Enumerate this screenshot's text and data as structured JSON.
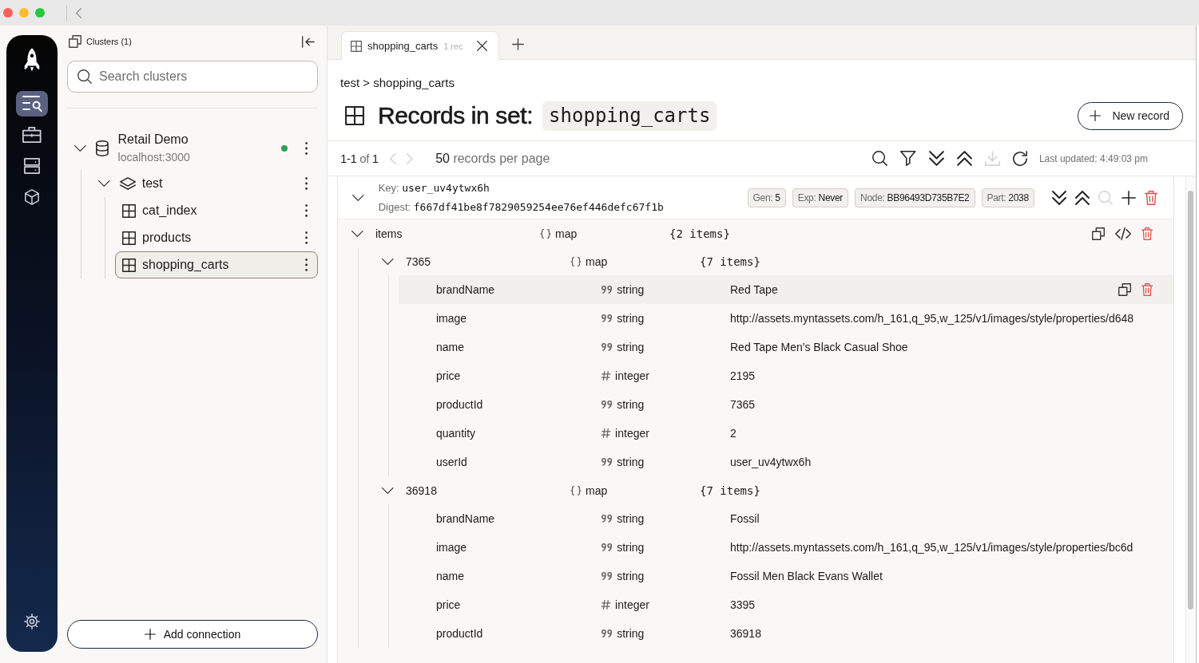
{
  "rail": {
    "items": [
      {
        "kind": "explorer",
        "selected": true
      },
      {
        "kind": "workspace",
        "selected": false
      },
      {
        "kind": "servers",
        "selected": false
      },
      {
        "kind": "modules",
        "selected": false
      }
    ],
    "footer": [
      {
        "kind": "settings",
        "selected": false
      }
    ]
  },
  "sidebar": {
    "title": "Clusters (1)",
    "search": {
      "placeholder": "Search clusters"
    },
    "tree": [
      {
        "kind": "cluster",
        "name": "Retail Demo",
        "host": "localhost:3000",
        "connected": true,
        "expanded": true,
        "selected": false,
        "children": [
          {
            "kind": "namespace",
            "name": "test",
            "expanded": true,
            "selected": false,
            "children": [
              {
                "kind": "set",
                "name": "cat_index",
                "selected": false
              },
              {
                "kind": "set",
                "name": "products",
                "selected": false
              },
              {
                "kind": "set",
                "name": "shopping_carts",
                "selected": true
              }
            ]
          }
        ]
      }
    ],
    "add_button": "Add connection"
  },
  "tabs": [
    {
      "label": "shopping_carts",
      "badge": "1 rec",
      "selected": true
    }
  ],
  "breadcrumb": "test > shopping_carts",
  "heading": {
    "title": "Records in set:",
    "set": "shopping_carts"
  },
  "new_record_button": "New record",
  "pagination": {
    "range": "1-1",
    "of": "of",
    "total": "1",
    "previous_disabled": true,
    "next_disabled": true,
    "page_size": "50",
    "page_size_label": "records per page"
  },
  "toolbar": [
    {
      "kind": "search",
      "disabled": false
    },
    {
      "kind": "filter",
      "disabled": false
    },
    {
      "kind": "expand-all",
      "disabled": false
    },
    {
      "kind": "collapse-all",
      "disabled": false
    },
    {
      "kind": "download",
      "disabled": true
    },
    {
      "kind": "refresh",
      "disabled": false
    }
  ],
  "last_updated": "Last updated: 4:49:03 pm",
  "records": [
    {
      "expanded": true,
      "key_label": "Key:",
      "key": "user_uv4ytwx6h",
      "digest_label": "Digest:",
      "digest": "f667df41be8f7829059254ee76ef446defc67f1b",
      "meta": [
        {
          "label": "Gen:",
          "value": "5"
        },
        {
          "label": "Exp:",
          "value": "Never"
        },
        {
          "label": "Node:",
          "value": "BB96493D735B7E2"
        },
        {
          "label": "Part:",
          "value": "2038"
        }
      ],
      "actions": [
        {
          "kind": "expand-all",
          "disabled": false
        },
        {
          "kind": "collapse-all",
          "disabled": false
        },
        {
          "kind": "search",
          "disabled": true
        },
        {
          "kind": "add",
          "disabled": false
        },
        {
          "kind": "delete",
          "disabled": false
        }
      ],
      "bins": [
        {
          "kind": "map",
          "name": "items",
          "type": "map",
          "value": "{2 items}",
          "expanded": true,
          "highlighted": false,
          "actions": [
            {
              "kind": "copy",
              "disabled": false
            },
            {
              "kind": "code",
              "disabled": false
            },
            {
              "kind": "delete",
              "disabled": false
            }
          ],
          "children": [
            {
              "kind": "map",
              "name": "7365",
              "type": "map",
              "value": "{7 items}",
              "expanded": true,
              "highlighted": false,
              "children": [
                {
                  "kind": "text",
                  "name": "brandName",
                  "type": "string",
                  "value": "Red Tape",
                  "highlighted": true,
                  "actions": [
                    {
                      "kind": "copy",
                      "disabled": false
                    },
                    {
                      "kind": "delete",
                      "disabled": false
                    }
                  ]
                },
                {
                  "kind": "text",
                  "name": "image",
                  "type": "string",
                  "value": "http://assets.myntassets.com/h_161,q_95,w_125/v1/images/style/properties/d648",
                  "highlighted": false
                },
                {
                  "kind": "text",
                  "name": "name",
                  "type": "string",
                  "value": "Red Tape Men's Black Casual Shoe",
                  "highlighted": false
                },
                {
                  "kind": "number",
                  "name": "price",
                  "type": "integer",
                  "value": "2195",
                  "highlighted": false
                },
                {
                  "kind": "text",
                  "name": "productId",
                  "type": "string",
                  "value": "7365",
                  "highlighted": false
                },
                {
                  "kind": "number",
                  "name": "quantity",
                  "type": "integer",
                  "value": "2",
                  "highlighted": false
                },
                {
                  "kind": "text",
                  "name": "userId",
                  "type": "string",
                  "value": "user_uv4ytwx6h",
                  "highlighted": false
                }
              ]
            },
            {
              "kind": "map",
              "name": "36918",
              "type": "map",
              "value": "{7 items}",
              "expanded": true,
              "highlighted": false,
              "children": [
                {
                  "kind": "text",
                  "name": "brandName",
                  "type": "string",
                  "value": "Fossil",
                  "highlighted": false
                },
                {
                  "kind": "text",
                  "name": "image",
                  "type": "string",
                  "value": "http://assets.myntassets.com/h_161,q_95,w_125/v1/images/style/properties/bc6d",
                  "highlighted": false
                },
                {
                  "kind": "text",
                  "name": "name",
                  "type": "string",
                  "value": "Fossil Men Black Evans Wallet",
                  "highlighted": false
                },
                {
                  "kind": "number",
                  "name": "price",
                  "type": "integer",
                  "value": "3395",
                  "highlighted": false
                },
                {
                  "kind": "text",
                  "name": "productId",
                  "type": "string",
                  "value": "36918",
                  "highlighted": false
                }
              ]
            }
          ]
        }
      ]
    }
  ]
}
